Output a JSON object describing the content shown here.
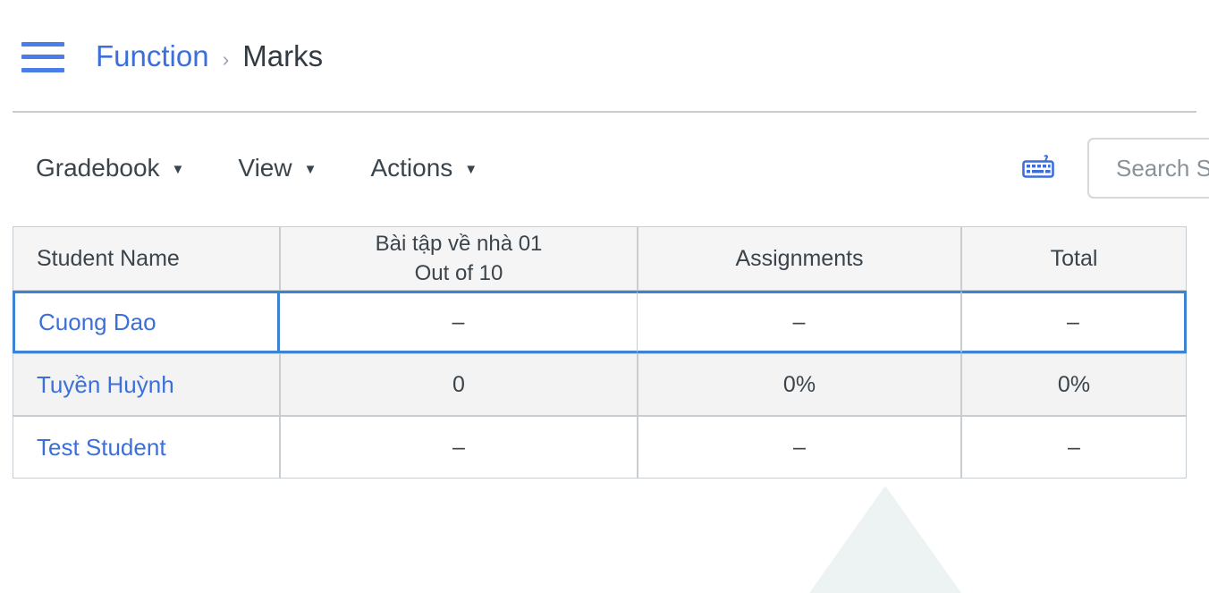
{
  "header": {
    "menu_icon": "hamburger-menu-icon",
    "breadcrumb": {
      "parent": "Function",
      "separator": "›",
      "current": "Marks"
    }
  },
  "toolbar": {
    "menus": [
      {
        "label": "Gradebook",
        "caret": "▼"
      },
      {
        "label": "View",
        "caret": "▼"
      },
      {
        "label": "Actions",
        "caret": "▼"
      }
    ],
    "keyboard_shortcuts_icon": "keyboard-icon",
    "search": {
      "value": "",
      "placeholder": "Search Students"
    }
  },
  "gradebook": {
    "columns": {
      "student_name": "Student Name",
      "assignment_title": "Bài tập về nhà 01",
      "assignment_points": "Out of 10",
      "assignment_group": "Assignments",
      "total": "Total"
    },
    "rows": [
      {
        "student": "Cuong Dao",
        "assignment": "–",
        "group": "–",
        "total": "–"
      },
      {
        "student": "Tuyền Huỳnh",
        "assignment": "0",
        "group": "0%",
        "total": "0%"
      },
      {
        "student": "Test Student",
        "assignment": "–",
        "group": "–",
        "total": "–"
      }
    ]
  },
  "colors": {
    "link_blue": "#3d6fd8",
    "focus_blue": "#3d83d4",
    "icon_blue": "#4a7de8",
    "header_grey": "#f5f5f5",
    "row_stripe": "#f3f3f3",
    "border_grey": "#c7cdd1",
    "watermark": "#edf3f3"
  }
}
